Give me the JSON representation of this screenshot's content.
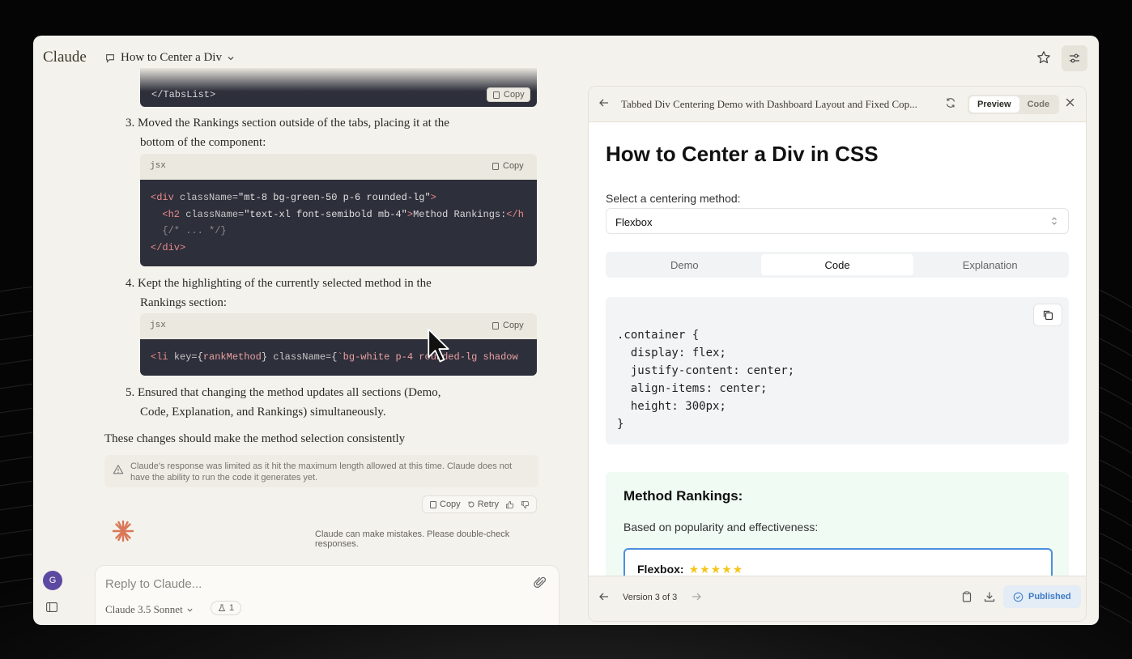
{
  "app": {
    "brand": "Claude",
    "conversation_title": "How to Center a Div"
  },
  "chat": {
    "top_code_line": "</TabsList>",
    "copy_label": "Copy",
    "items": [
      {
        "num": "3.",
        "line1": "Moved the Rankings section outside of the tabs, placing it at the",
        "line2": "bottom of the component:"
      },
      {
        "num": "4.",
        "line1": "Kept the highlighting of the currently selected method in the",
        "line2": "Rankings section:"
      },
      {
        "num": "5.",
        "line1": "Ensured that changing the method updates all sections (Demo,",
        "line2": "Code, Explanation, and Rankings) simultaneously."
      }
    ],
    "lang": "jsx",
    "closing": "These changes should make the method selection consistently",
    "warning": "Claude's response was limited as it hit the maximum length allowed at this time. Claude does not have the ability to run the code it generates yet.",
    "actions": {
      "copy": "Copy",
      "retry": "Retry"
    },
    "disclaimer": "Claude can make mistakes. Please double-check responses."
  },
  "composer": {
    "avatar_initial": "G",
    "placeholder": "Reply to Claude...",
    "model": "Claude 3.5 Sonnet",
    "count": "1"
  },
  "artifact": {
    "title": "Tabbed Div Centering Demo with Dashboard Layout and Fixed Cop...",
    "seg": {
      "preview": "Preview",
      "code": "Code"
    },
    "heading": "How to Center a Div in CSS",
    "select_label": "Select a centering method:",
    "select_value": "Flexbox",
    "tabs": [
      "Demo",
      "Code",
      "Explanation"
    ],
    "css_code": ".container {\n  display: flex;\n  justify-content: center;\n  align-items: center;\n  height: 300px;\n}",
    "rankings": {
      "title": "Method Rankings:",
      "subtitle": "Based on popularity and effectiveness:",
      "first_method": "Flexbox:",
      "first_stars": "★★★★★"
    },
    "footer": {
      "version": "Version 3 of 3",
      "published": "Published"
    }
  }
}
